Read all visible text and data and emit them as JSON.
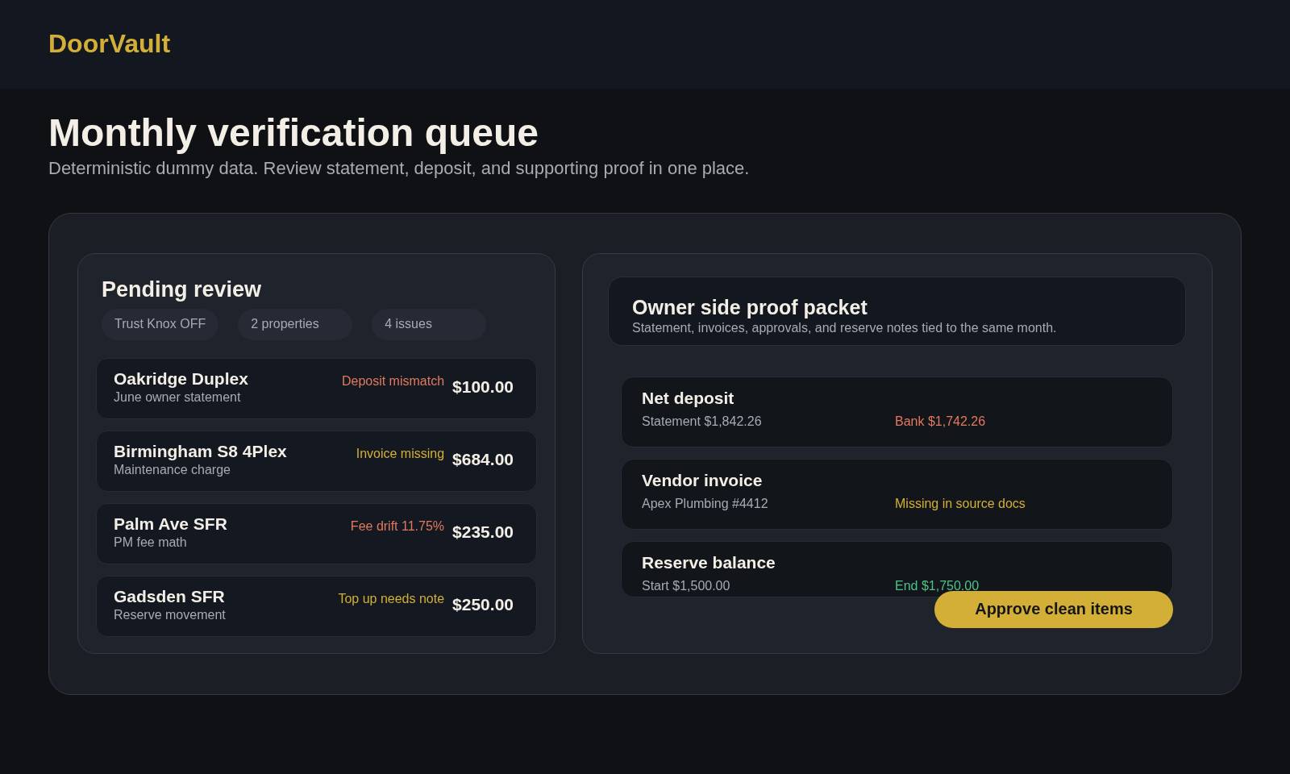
{
  "brand": "DoorVault",
  "page": {
    "title": "Monthly verification queue",
    "subtitle": "Deterministic dummy data. Review statement, deposit, and supporting proof in one place."
  },
  "pending": {
    "title": "Pending review",
    "chips": [
      "Trust Knox OFF",
      "2 properties",
      "4 issues"
    ],
    "items": [
      {
        "name": "Oakridge Duplex",
        "detail": "June owner statement",
        "flag": "Deposit mismatch",
        "color": "#e3795e",
        "amount": "$100.00"
      },
      {
        "name": "Birmingham S8 4Plex",
        "detail": "Maintenance charge",
        "flag": "Invoice missing",
        "color": "#d4af37",
        "amount": "$684.00"
      },
      {
        "name": "Palm Ave SFR",
        "detail": "PM fee math",
        "flag": "Fee drift 11.75%",
        "color": "#e3795e",
        "amount": "$235.00"
      },
      {
        "name": "Gadsden SFR",
        "detail": "Reserve movement",
        "flag": "Top up needs note",
        "color": "#d4af37",
        "amount": "$250.00"
      }
    ]
  },
  "packet": {
    "title": "Owner side proof packet",
    "subtitle": "Statement, invoices, approvals, and reserve notes tied to the same month.",
    "checks": [
      {
        "title": "Net deposit",
        "left": "Statement $1,842.26",
        "right": "Bank $1,742.26",
        "color": "#e3795e"
      },
      {
        "title": "Vendor invoice",
        "left": "Apex Plumbing #4412",
        "right": "Missing in source docs",
        "color": "#d4af37"
      },
      {
        "title": "Reserve balance",
        "left": "Start $1,500.00",
        "right": "End $1,750.00",
        "color": "#4cc38a"
      }
    ],
    "action": "Approve clean items"
  }
}
